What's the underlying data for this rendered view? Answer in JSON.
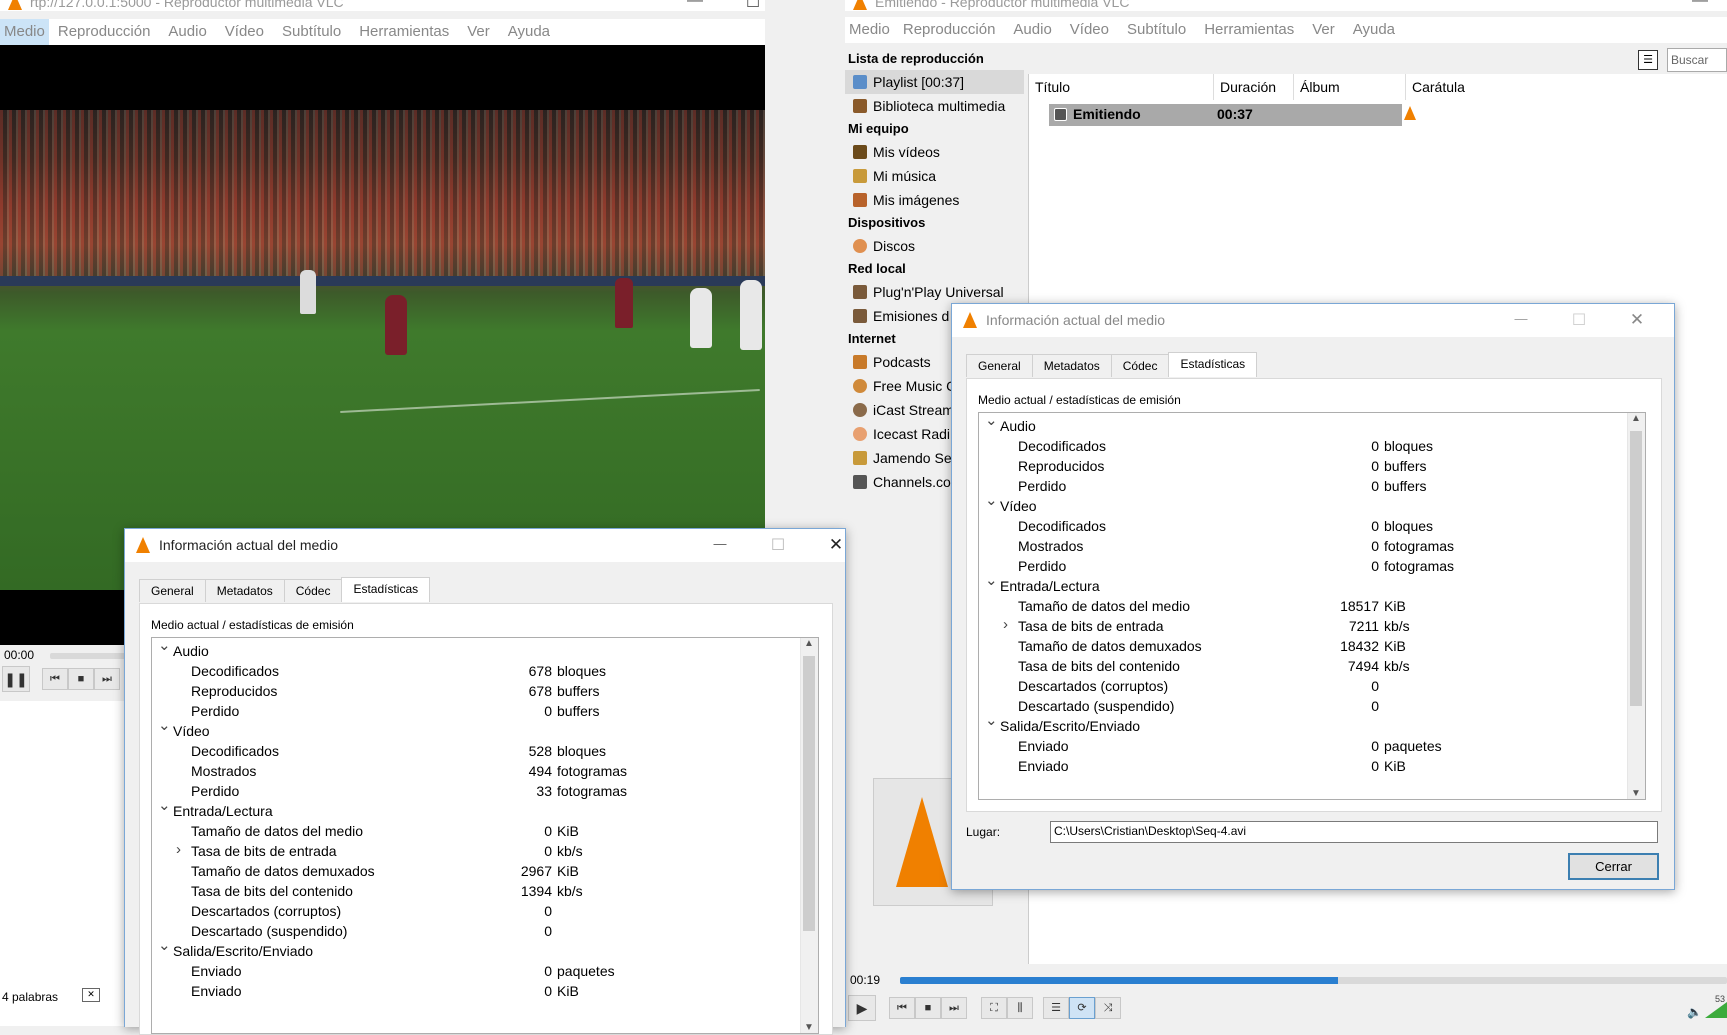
{
  "left_window": {
    "title": "rtp://127.0.0.1:5000 - Reproductor multimedia VLC",
    "menu": [
      "Medio",
      "Reproducción",
      "Audio",
      "Vídeo",
      "Subtítulo",
      "Herramientas",
      "Ver",
      "Ayuda"
    ],
    "time": "00:00",
    "status_text": "4 palabras"
  },
  "right_window": {
    "title": "Emitiendo - Reproductor multimedia VLC",
    "menu": [
      "Medio",
      "Reproducción",
      "Audio",
      "Vídeo",
      "Subtítulo",
      "Herramientas",
      "Ver",
      "Ayuda"
    ],
    "search_placeholder": "Buscar",
    "sidebar": {
      "playlist_header": "Lista de reproducción",
      "playlist_items": [
        "Playlist [00:37]",
        "Biblioteca multimedia"
      ],
      "mi_equipo_header": "Mi equipo",
      "mi_equipo_items": [
        "Mis vídeos",
        "Mi música",
        "Mis imágenes"
      ],
      "dispositivos_header": "Dispositivos",
      "dispositivos_items": [
        "Discos"
      ],
      "red_local_header": "Red local",
      "red_local_items": [
        "Plug'n'Play Universal",
        "Emisiones d"
      ],
      "internet_header": "Internet",
      "internet_items": [
        "Podcasts",
        "Free Music C",
        "iCast Stream",
        "Icecast Radi",
        "Jamendo Se",
        "Channels.co"
      ]
    },
    "columns": [
      "Título",
      "Duración",
      "Álbum",
      "Carátula"
    ],
    "playlist_row": {
      "title": "Emitiendo",
      "duration": "00:37"
    },
    "time": "00:19",
    "progress": 0.53,
    "volume": "53"
  },
  "dialog_common": {
    "title": "Información actual del medio",
    "tabs": [
      "General",
      "Metadatos",
      "Códec",
      "Estadísticas"
    ],
    "caption": "Medio actual / estadísticas de emisión",
    "section_audio": "Audio",
    "section_video": "Vídeo",
    "section_input": "Entrada/Lectura",
    "section_output": "Salida/Escrito/Enviado",
    "decodificados": "Decodificados",
    "reproducidos": "Reproducidos",
    "perdido": "Perdido",
    "mostrados": "Mostrados",
    "tamano_medio": "Tamaño de datos del medio",
    "tasa_entrada": "Tasa de bits de entrada",
    "tamano_demux": "Tamaño de datos demuxados",
    "tasa_contenido": "Tasa de bits del contenido",
    "desc_corruptos": "Descartados (corruptos)",
    "desc_suspendido": "Descartado (suspendido)",
    "enviado": "Enviado",
    "enviado_next": "Enviado",
    "u_bloques": "bloques",
    "u_buffers": "buffers",
    "u_fotogramas": "fotogramas",
    "u_kib": "KiB",
    "u_kbs": "kb/s",
    "u_paquetes": "paquetes",
    "lugar_label": "Lugar:",
    "close_label": "Cerrar"
  },
  "dialog_left": {
    "audio_decoded": "678",
    "audio_played": "678",
    "audio_lost": "0",
    "video_decoded": "528",
    "video_shown": "494",
    "video_lost": "33",
    "input_size": "0",
    "input_bitrate": "0",
    "demux_size": "2967",
    "content_bitrate": "1394",
    "discarded_corrupt": "0",
    "discarded_suspended": "0",
    "sent_packets": "0",
    "sent_next": "0"
  },
  "dialog_right": {
    "audio_decoded": "0",
    "audio_played": "0",
    "audio_lost": "0",
    "video_decoded": "0",
    "video_shown": "0",
    "video_lost": "0",
    "input_size": "18517",
    "input_bitrate": "7211",
    "demux_size": "18432",
    "content_bitrate": "7494",
    "discarded_corrupt": "0",
    "discarded_suspended": "0",
    "sent_packets": "0",
    "sent_next": "0",
    "location": "C:\\Users\\Cristian\\Desktop\\Seq-4.avi"
  },
  "colors": {
    "vlc_orange": "#f08000",
    "accent_blue": "#2a7fd0",
    "selection": "#a9a9a9"
  }
}
